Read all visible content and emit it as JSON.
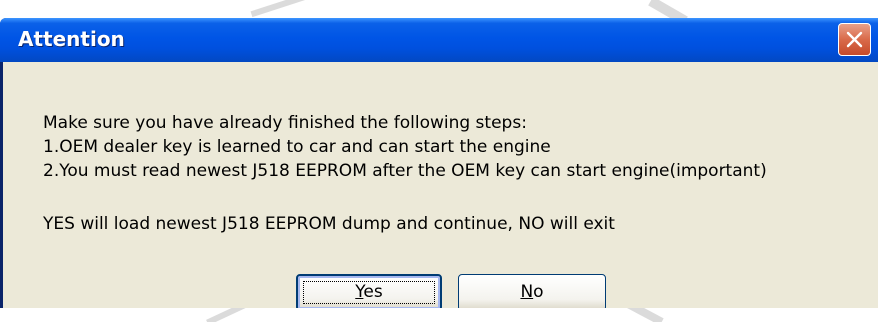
{
  "window": {
    "title": "Attention"
  },
  "message": {
    "line1": "Make sure you have already finished the following steps:",
    "line2": "1.OEM dealer key is learned to car and can start the engine",
    "line3": "2.You must read newest J518 EEPROM after the OEM key can start engine(important)",
    "line4": "YES will load newest J518 EEPROM dump and continue, NO will exit"
  },
  "buttons": {
    "yes": {
      "mnemonic": "Y",
      "rest": "es"
    },
    "no": {
      "mnemonic": "N",
      "rest": "o"
    }
  },
  "icons": {
    "close": "close-icon"
  },
  "colors": {
    "title_bar": "#0055e6",
    "dialog_face": "#ece9d8",
    "close_button": "#d96a4a"
  }
}
